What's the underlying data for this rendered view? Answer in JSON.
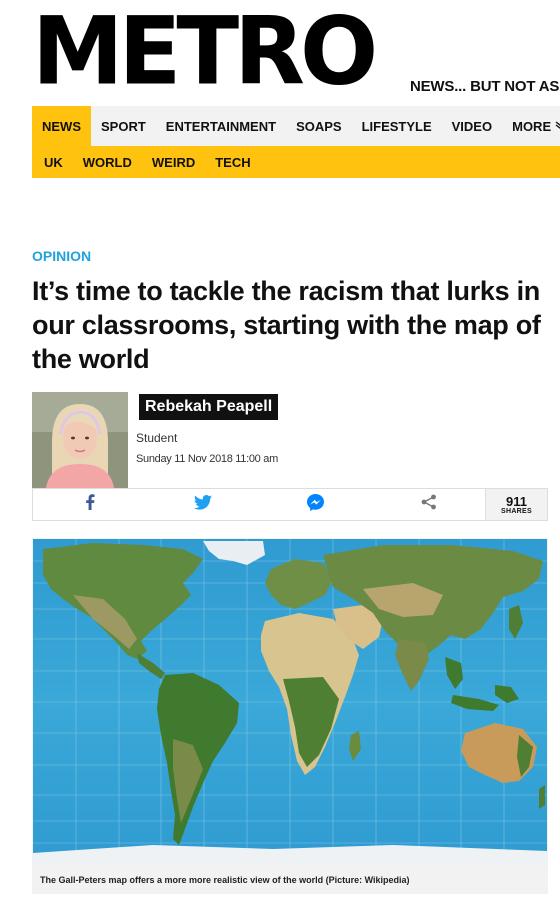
{
  "brand": {
    "logo": "METRO",
    "tagline": "NEWS... BUT NOT AS"
  },
  "nav": {
    "primary": [
      {
        "label": "NEWS",
        "active": true
      },
      {
        "label": "SPORT"
      },
      {
        "label": "ENTERTAINMENT"
      },
      {
        "label": "SOAPS"
      },
      {
        "label": "LIFESTYLE"
      },
      {
        "label": "VIDEO"
      },
      {
        "label": "MORE"
      }
    ],
    "secondary": [
      {
        "label": "UK"
      },
      {
        "label": "WORLD"
      },
      {
        "label": "WEIRD"
      },
      {
        "label": "TECH"
      }
    ]
  },
  "article": {
    "category": "OPINION",
    "headline": "It’s time to tackle the racism that lurks in our classrooms, starting with the map of the world",
    "author": {
      "name": "Rebekah Peapell",
      "role": "Student",
      "date": "Sunday 11 Nov 2018 11:00 am"
    },
    "share": {
      "buttons": [
        "facebook-icon",
        "twitter-icon",
        "messenger-icon",
        "share-icon"
      ],
      "count": "911",
      "count_label": "SHARES"
    },
    "image": {
      "caption": "The Gall-Peters map offers a more more realistic view of the world (Picture: Wikipedia)"
    }
  },
  "colors": {
    "accent_yellow": "#ffc20e",
    "opinion_blue": "#1fa2de",
    "ocean": "#3aa8d8"
  }
}
